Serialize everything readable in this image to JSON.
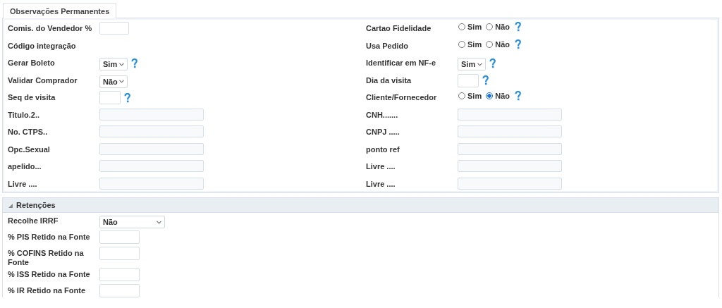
{
  "tabs": [
    {
      "label": "Observações Permanentes",
      "selected": true
    }
  ],
  "panel": {
    "left": [
      {
        "label": "Comis. do Vendedor %",
        "kind": "short"
      },
      {
        "label": "Código integração",
        "kind": "none"
      },
      {
        "label": "Gerar Boleto",
        "kind": "select",
        "value": "Sim",
        "help": true
      },
      {
        "label": "Validar Comprador",
        "kind": "select",
        "value": "Não"
      },
      {
        "label": "Seq de visita",
        "kind": "tiny",
        "help": true
      },
      {
        "label": "Titulo.2..",
        "kind": "wide"
      },
      {
        "label": "No. CTPS..",
        "kind": "wide"
      },
      {
        "label": "Opc.Sexual",
        "kind": "wide"
      },
      {
        "label": "apelido...",
        "kind": "wide"
      },
      {
        "label": "Livre ....",
        "kind": "wide"
      }
    ],
    "right": [
      {
        "label": "Cartao Fidelidade",
        "kind": "radio",
        "options": [
          {
            "label": "Sim",
            "selected": false
          },
          {
            "label": "Não",
            "selected": false
          }
        ],
        "help": true
      },
      {
        "label": "Usa Pedido",
        "kind": "radio",
        "options": [
          {
            "label": "Sim",
            "selected": false
          },
          {
            "label": "Não",
            "selected": false
          }
        ],
        "help": true
      },
      {
        "label": "Identificar em NF-e",
        "kind": "select",
        "value": "Sim",
        "help": true
      },
      {
        "label": "Dia da visita",
        "kind": "tiny",
        "help": true
      },
      {
        "label": "Cliente/Fornecedor",
        "kind": "radio",
        "options": [
          {
            "label": "Sim",
            "selected": false
          },
          {
            "label": "Não",
            "selected": true
          }
        ],
        "help": true
      },
      {
        "label": "CNH.......",
        "kind": "wide"
      },
      {
        "label": "CNPJ .....",
        "kind": "wide"
      },
      {
        "label": "ponto ref",
        "kind": "wide"
      },
      {
        "label": "Livre ....",
        "kind": "wide"
      },
      {
        "label": "Livre ....",
        "kind": "wide"
      }
    ]
  },
  "retencoes": {
    "title": "Retenções",
    "expanded": true,
    "fields": [
      {
        "label": "Recolhe IRRF",
        "kind": "longselect",
        "value": "Não"
      },
      {
        "label": "% PIS Retido na Fonte",
        "kind": "medium"
      },
      {
        "label": "% COFINS Retido na Fonte",
        "kind": "medium"
      },
      {
        "label": "% ISS Retido na Fonte",
        "kind": "medium"
      },
      {
        "label": "% IR Retido na Fonte",
        "kind": "medium"
      }
    ]
  }
}
